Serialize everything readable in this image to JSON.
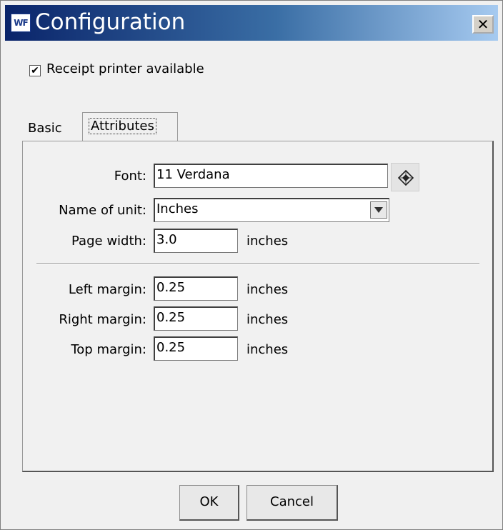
{
  "window": {
    "title": "Configuration",
    "icon_text": "WF",
    "close_glyph": "✕"
  },
  "receipt_printer": {
    "label": "Receipt printer available",
    "checked": true
  },
  "tabs": [
    {
      "label": "Basic",
      "active": false
    },
    {
      "label": "Attributes",
      "active": true
    }
  ],
  "attributes": {
    "font": {
      "label": "Font:",
      "value": "11 Verdana"
    },
    "unit": {
      "label": "Name of unit:",
      "value": "Inches"
    },
    "page_width": {
      "label": "Page width:",
      "value": "3.0",
      "unit": "inches"
    },
    "left_margin": {
      "label": "Left margin:",
      "value": "0.25",
      "unit": "inches"
    },
    "right_margin": {
      "label": "Right margin:",
      "value": "0.25",
      "unit": "inches"
    },
    "top_margin": {
      "label": "Top margin:",
      "value": "0.25",
      "unit": "inches"
    }
  },
  "buttons": {
    "ok": "OK",
    "cancel": "Cancel"
  },
  "icons": {
    "font_picker": "font-picker-icon",
    "dropdown": "chevron-down-icon"
  },
  "colors": {
    "titlebar_start": "#0a246a",
    "titlebar_end": "#a6caf0"
  }
}
